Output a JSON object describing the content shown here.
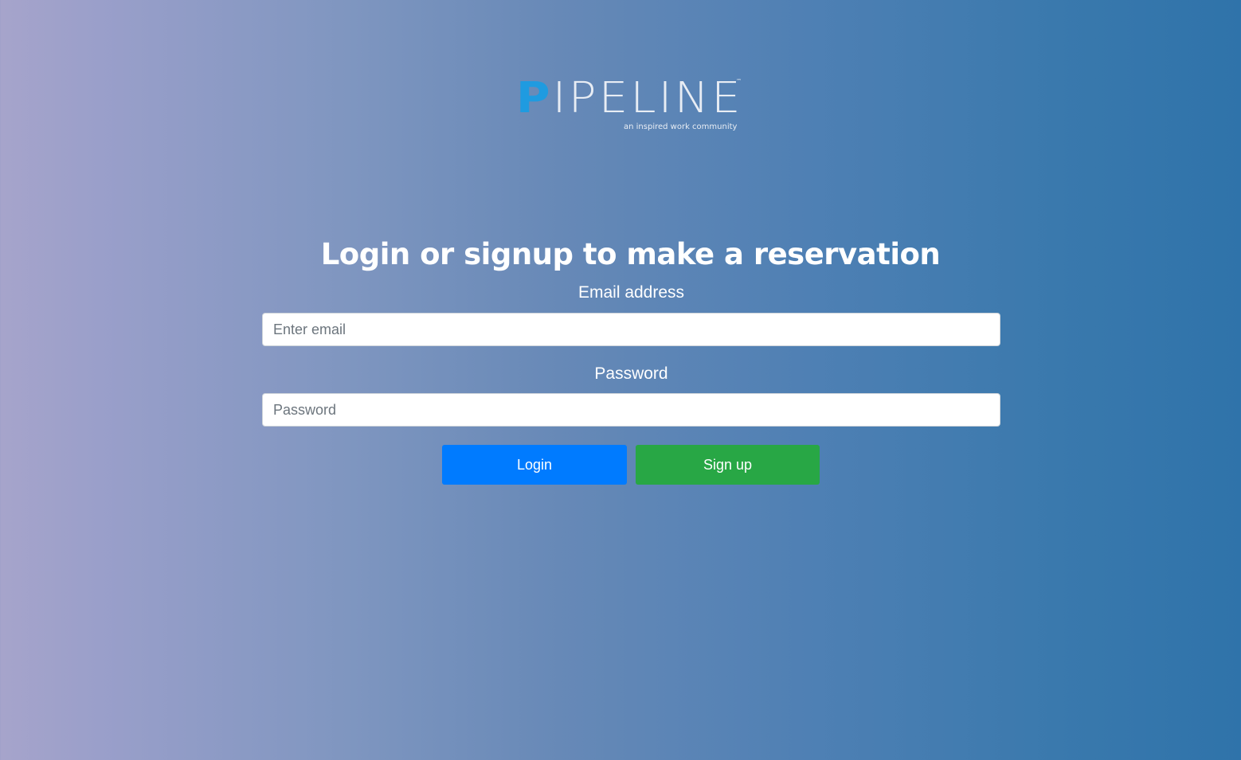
{
  "logo": {
    "first_letter": "P",
    "rest": "IPELINE",
    "trademark": "™",
    "tagline": "an inspired work community"
  },
  "heading": "Login or signup to make a reservation",
  "form": {
    "email_label": "Email address",
    "email_placeholder": "Enter email",
    "password_label": "Password",
    "password_placeholder": "Password"
  },
  "buttons": {
    "login_label": "Login",
    "signup_label": "Sign up"
  },
  "colors": {
    "login_button": "#007bff",
    "signup_button": "#28a745",
    "logo_accent": "#1f9be0"
  }
}
